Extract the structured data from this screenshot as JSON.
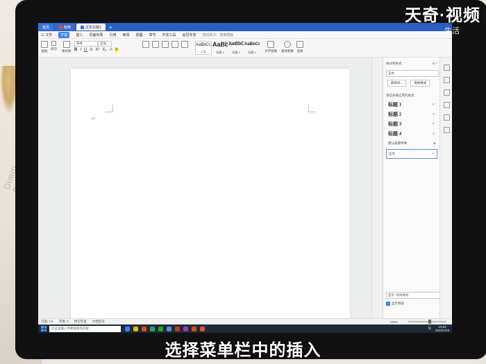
{
  "watermark": {
    "brand": "天奇·视频",
    "overlay_text": "生活"
  },
  "subtitle": "选择菜单栏中的插入",
  "desk": {
    "text": "Dimiti Duran"
  },
  "titlebar": {
    "tabs": [
      {
        "label": "首页"
      },
      {
        "label": "稻壳"
      },
      {
        "label": "文字文稿1"
      }
    ],
    "new_tab": "+"
  },
  "menubar": {
    "file": "三 文件",
    "items": [
      "开始",
      "插入",
      "页面布局",
      "引用",
      "审阅",
      "视图",
      "章节",
      "开发工具",
      "会员专享"
    ],
    "search": "查找命令、搜索模板"
  },
  "ribbon": {
    "paste": "粘贴",
    "cut": "剪切",
    "copy": "复制",
    "format_painter": "格式刷",
    "font_name": "宋体",
    "font_size": "五号",
    "format_glyphs": [
      "B",
      "I",
      "U",
      "A",
      "X²",
      "X₂",
      "A",
      "A"
    ],
    "styles": [
      {
        "sample": "AaBbCcDd",
        "label": "正文"
      },
      {
        "sample": "AaBb",
        "label": "标题 1"
      },
      {
        "sample": "AaBbC",
        "label": "标题 2"
      },
      {
        "sample": "AaBbCc",
        "label": "标题 3"
      }
    ],
    "text_layout": "文字排版",
    "find_replace": "查找替换",
    "select": "选择"
  },
  "pane": {
    "title": "样式和格式",
    "current_style": "正文",
    "new_style": "新样式...",
    "clear_format": "清除格式",
    "apply_label": "请选择要应用的格式",
    "styles": [
      {
        "name": "标题 1",
        "heading": true
      },
      {
        "name": "标题 2",
        "heading": true
      },
      {
        "name": "标题 3",
        "heading": true
      },
      {
        "name": "标题 4",
        "heading": true
      },
      {
        "name": "默认段落字体",
        "heading": false
      },
      {
        "name": "正文",
        "heading": false,
        "selected": true
      }
    ],
    "show_label": "显示: 有效样式",
    "preview_label": "显示预览"
  },
  "statusbar": {
    "page": "页面: 1/1",
    "words": "字数: 0",
    "spellcheck": "拼写检查",
    "compat": "文档校对",
    "zoom": "100%"
  },
  "taskbar": {
    "search_placeholder": "在这里输入你要搜索的内容",
    "time": "10:53",
    "date": "2022/1/19",
    "ime": "英"
  }
}
